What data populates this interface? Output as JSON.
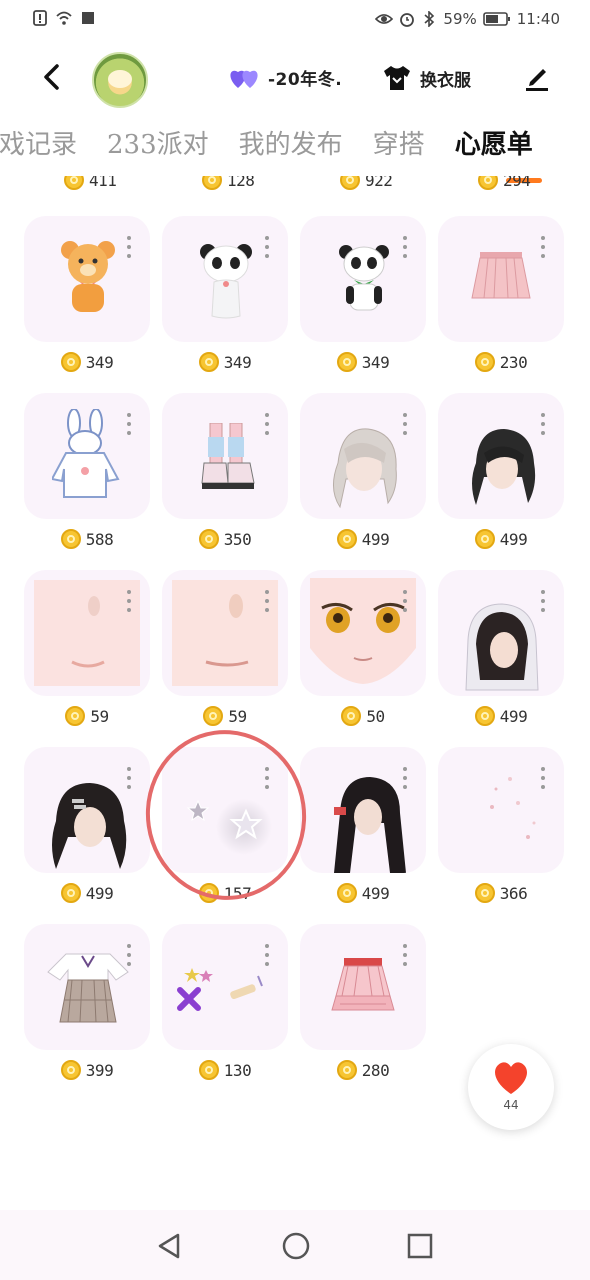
{
  "status": {
    "battery": "59%",
    "time": "11:40"
  },
  "header": {
    "username": "-20年冬.",
    "dress_label": "换衣服"
  },
  "tabs": [
    {
      "label": "游戏记录"
    },
    {
      "label": "233派对"
    },
    {
      "label": "我的发布"
    },
    {
      "label": "穿搭"
    },
    {
      "label": "心愿单"
    }
  ],
  "partial_prices": [
    "411",
    "128",
    "922",
    "294"
  ],
  "items": [
    {
      "name": "bear-plush",
      "price": "349"
    },
    {
      "name": "panda-white",
      "price": "349"
    },
    {
      "name": "panda-bow",
      "price": "349"
    },
    {
      "name": "pink-skirt",
      "price": "230"
    },
    {
      "name": "bunny-hoodie",
      "price": "588"
    },
    {
      "name": "leg-warmers",
      "price": "350"
    },
    {
      "name": "silver-hair",
      "price": "499"
    },
    {
      "name": "black-hair-ponytail",
      "price": "499"
    },
    {
      "name": "blush-face-1",
      "price": "59"
    },
    {
      "name": "blush-face-2",
      "price": "59"
    },
    {
      "name": "anime-eyes",
      "price": "50"
    },
    {
      "name": "black-hair-hood",
      "price": "499"
    },
    {
      "name": "black-hair-clip",
      "price": "499"
    },
    {
      "name": "star-effect",
      "price": "157"
    },
    {
      "name": "black-long-hair",
      "price": "499"
    },
    {
      "name": "sparkle-effect",
      "price": "366"
    },
    {
      "name": "plaid-dress",
      "price": "399"
    },
    {
      "name": "candy-accessories",
      "price": "130"
    },
    {
      "name": "ruffle-skirt",
      "price": "280"
    }
  ],
  "fab": {
    "count": "44"
  },
  "colors": {
    "accent": "#ff7a1e",
    "card_bg": "#faf3fb",
    "coin": "#f7c532",
    "annotation": "#e46a6a"
  }
}
